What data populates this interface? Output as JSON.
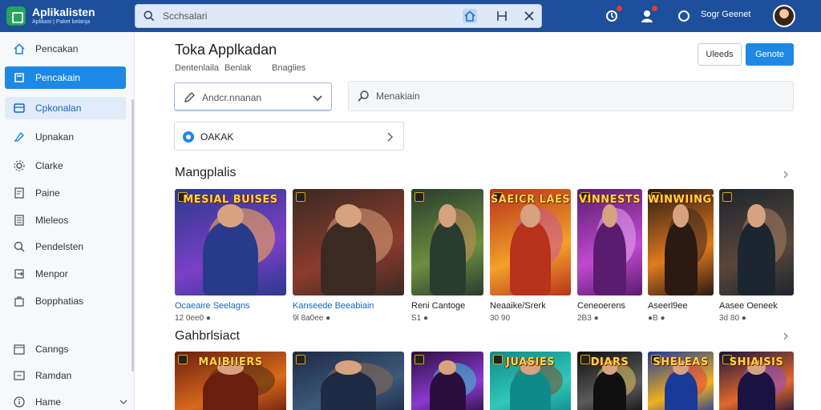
{
  "app": {
    "name": "Aplikalisten",
    "tagline": "Aplikasi | Paket belanja"
  },
  "search": {
    "placeholder": "Scchsalari"
  },
  "user": {
    "name": "Sogr Geenet"
  },
  "sidebar": {
    "items": [
      {
        "label": "Pencakan",
        "icon": "home-icon",
        "state": "normal"
      },
      {
        "label": "Pencakain",
        "icon": "store-icon",
        "state": "active"
      },
      {
        "label": "Cpkonalan",
        "icon": "grid-icon",
        "state": "soft"
      },
      {
        "label": "Upnakan",
        "icon": "upload-icon",
        "state": "normal"
      },
      {
        "label": "Clarke",
        "icon": "gear-icon",
        "state": "normal"
      },
      {
        "label": "Paine",
        "icon": "document-icon",
        "state": "normal"
      },
      {
        "label": "Mleleos",
        "icon": "list-icon",
        "state": "normal"
      },
      {
        "label": "Pendelsten",
        "icon": "search-icon",
        "state": "normal"
      },
      {
        "label": "Menpor",
        "icon": "export-icon",
        "state": "normal"
      },
      {
        "label": "Bopphatias",
        "icon": "bag-icon",
        "state": "normal"
      },
      {
        "label": "Canngs",
        "icon": "calendar-icon",
        "state": "normal"
      },
      {
        "label": "Ramdan",
        "icon": "folder-icon",
        "state": "normal"
      },
      {
        "label": "Hame",
        "icon": "info-icon",
        "state": "normal"
      }
    ]
  },
  "main": {
    "title": "Toka Applkadan",
    "breadcrumbs": [
      "Dentenlaila",
      "Benlak",
      "Bnaglies"
    ],
    "buttons": {
      "secondary": "Uleeds",
      "primary": "Genote"
    },
    "category_select": {
      "value": "Andcr.nnanan"
    },
    "search_field": {
      "placeholder": "Menakiain"
    },
    "chip": {
      "label": "OAKAK"
    },
    "sections": [
      {
        "title": "Mangplalis",
        "cards": [
          {
            "title": "Ocaeaire Seelagns",
            "meta": "12 0ee0 ●",
            "art_text": "MESIAL BUISES"
          },
          {
            "title": "Kanseede Beeabiain",
            "meta": "9l 8a0ee ●",
            "art_text": ""
          },
          {
            "title": "Reni Cantoge",
            "meta": "S1 ●",
            "art_text": ""
          },
          {
            "title": "Neaaike/Srerk",
            "meta": "30 90",
            "art_text": "SAEICR LAES"
          },
          {
            "title": "Ceneoerens",
            "meta": "2B3 ●",
            "art_text": "VINNESTS"
          },
          {
            "title": "Aseerl9ee",
            "meta": "●B ●",
            "art_text": "WINWIINGY"
          },
          {
            "title": "Aasee Oeneek",
            "meta": "3d 80 ●",
            "art_text": ""
          }
        ]
      },
      {
        "title": "Gahbrlsiact",
        "cards": [
          {
            "title": "",
            "meta": "",
            "art_text": "MAIBIIERS"
          },
          {
            "title": "",
            "meta": "",
            "art_text": ""
          },
          {
            "title": "",
            "meta": "",
            "art_text": ""
          },
          {
            "title": "",
            "meta": "",
            "art_text": "JUASIES"
          },
          {
            "title": "",
            "meta": "",
            "art_text": "DIARS"
          },
          {
            "title": "",
            "meta": "",
            "art_text": "SHELEAS"
          },
          {
            "title": "",
            "meta": "",
            "art_text": "SHIAISIS"
          }
        ]
      }
    ]
  },
  "colors": {
    "topbar": "#1d4f9c",
    "accent": "#1e88e5",
    "brand_green": "#21a65a"
  }
}
